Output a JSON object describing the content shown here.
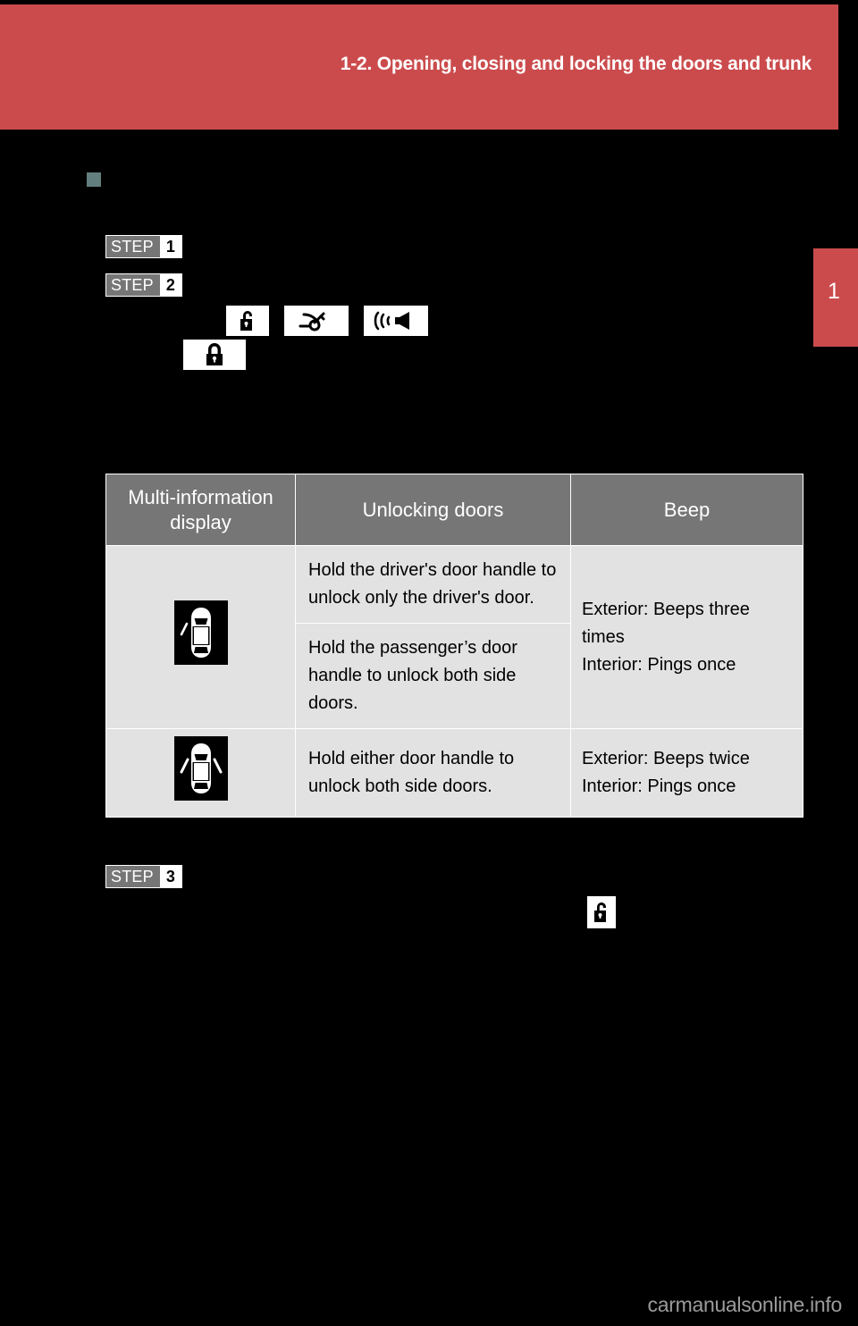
{
  "header": {
    "title": "1-2. Opening, closing and locking the doors and trunk",
    "band_color": "#cb4b4d"
  },
  "chapter_tab": {
    "number": "1",
    "color": "#cb4b4d"
  },
  "section": {
    "bullet_color": "#637e7e"
  },
  "steps": [
    {
      "word": "STEP",
      "number": "1"
    },
    {
      "word": "STEP",
      "number": "2"
    },
    {
      "word": "STEP",
      "number": "3"
    }
  ],
  "inline_icons": [
    {
      "name": "unlock-icon"
    },
    {
      "name": "key-icon"
    },
    {
      "name": "beep-speaker-icon"
    },
    {
      "name": "lock-icon"
    },
    {
      "name": "unlock-icon"
    }
  ],
  "table": {
    "headers": [
      "Multi-information display",
      "Unlocking doors",
      "Beep"
    ],
    "rows": [
      {
        "display_icon": "car-driver-door-unlock-icon",
        "instructions": [
          "Hold the driver's door handle to unlock only the driver's door.",
          "Hold the passenger’s door handle to unlock both side doors."
        ],
        "beep": "Exterior: Beeps three times\nInterior: Pings once",
        "beep_lines": [
          "Exterior: Beeps three times",
          "Interior: Pings once"
        ]
      },
      {
        "display_icon": "car-both-doors-unlock-icon",
        "instructions": [
          "Hold either door handle to unlock both side doors."
        ],
        "beep_lines": [
          "Exterior: Beeps twice",
          "Interior: Pings once"
        ]
      }
    ]
  },
  "watermark": {
    "text": "carmanualsonline.info",
    "color": "#9b9b9b"
  },
  "page_background": "#000000"
}
